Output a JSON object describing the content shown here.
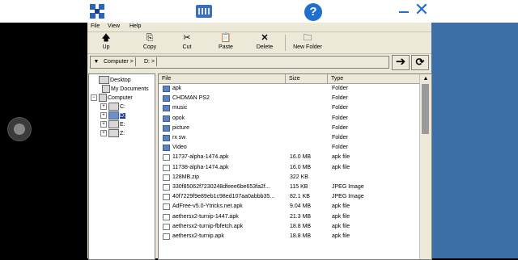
{
  "overlay": {
    "icons": [
      "app-icon",
      "keyboard-icon",
      "help-icon",
      "minimize-icon",
      "close-icon"
    ],
    "help_label": "?",
    "close_label": "✕"
  },
  "menu": {
    "items": [
      "File",
      "View",
      "Help"
    ]
  },
  "toolbar": {
    "up": "Up",
    "copy": "Copy",
    "cut": "Cut",
    "paste": "Paste",
    "delete": "Delete",
    "new_folder": "New Folder"
  },
  "address": {
    "crumbs": [
      "Computer >",
      "D: >"
    ],
    "go_icon": "➔",
    "refresh_icon": "⟳"
  },
  "tree": {
    "desktop": "Desktop",
    "my_documents": "My Documents",
    "computer": "Computer",
    "drives": [
      "C:",
      "D:",
      "E:",
      "Z:"
    ],
    "selected": "D:"
  },
  "columns": {
    "file": "File",
    "size": "Size",
    "type": "Type"
  },
  "files": [
    {
      "name": "apk",
      "size": "",
      "type": "Folder",
      "kind": "folder"
    },
    {
      "name": "CHDMAN PS2",
      "size": "",
      "type": "Folder",
      "kind": "folder"
    },
    {
      "name": "music",
      "size": "",
      "type": "Folder",
      "kind": "folder"
    },
    {
      "name": "opok",
      "size": "",
      "type": "Folder",
      "kind": "folder"
    },
    {
      "name": "picture",
      "size": "",
      "type": "Folder",
      "kind": "folder"
    },
    {
      "name": "rx sw",
      "size": "",
      "type": "Folder",
      "kind": "folder"
    },
    {
      "name": "Video",
      "size": "",
      "type": "Folder",
      "kind": "folder"
    },
    {
      "name": "11737-alpha-1474.apk",
      "size": "16.0 MB",
      "type": "apk file",
      "kind": "file"
    },
    {
      "name": "11738-alpha-1474.apk",
      "size": "16.0 MB",
      "type": "apk file",
      "kind": "file"
    },
    {
      "name": "128MB.zip",
      "size": "322 KB",
      "type": "",
      "kind": "file"
    },
    {
      "name": "330f85062f7230248dfeee6be653fa2f...",
      "size": "115 KB",
      "type": "JPEG Image",
      "kind": "file"
    },
    {
      "name": "40f7229f9e89eb1c98ed107aa0abbb35...",
      "size": "82.1 KB",
      "type": "JPEG Image",
      "kind": "file"
    },
    {
      "name": "AdFree-v5.0-Ytricks.net.apk",
      "size": "9.04 MB",
      "type": "apk file",
      "kind": "file"
    },
    {
      "name": "aethersx2-turnip-1447.apk",
      "size": "21.3 MB",
      "type": "apk file",
      "kind": "file"
    },
    {
      "name": "aethersx2-turnip-fbfetch.apk",
      "size": "18.8 MB",
      "type": "apk file",
      "kind": "file"
    },
    {
      "name": "aethersx2-turnip.apk",
      "size": "18.8 MB",
      "type": "apk file",
      "kind": "file"
    }
  ],
  "colors": {
    "window_bg": "#ece9d8",
    "selection": "#1a3f8f",
    "folder": "#5d82c4",
    "overlay_blue": "#1f6fd1",
    "desktop_blue": "#3b6fa5"
  }
}
